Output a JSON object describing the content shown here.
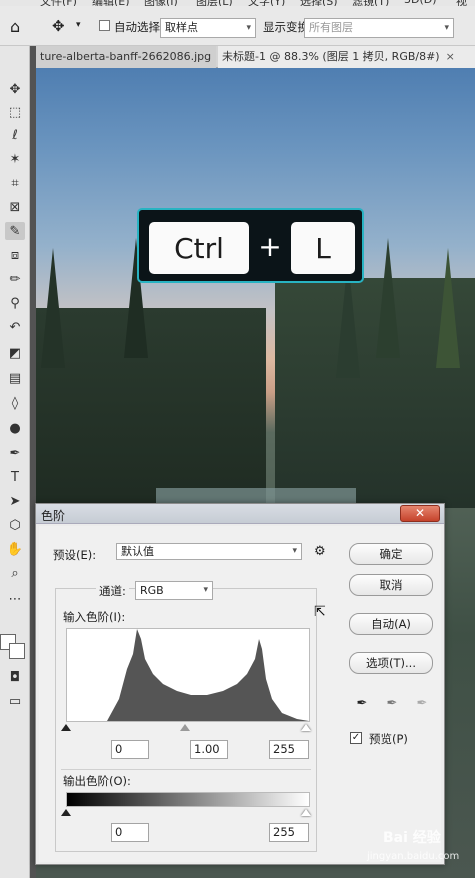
{
  "menubar": {
    "items": [
      "文件(F)",
      "编辑(E)",
      "图像(I)",
      "图层(L)",
      "文字(Y)",
      "选择(S)",
      "滤镜(T)",
      "3D(D)",
      "视图(V)"
    ]
  },
  "optbar": {
    "auto_select_label": "自动选择",
    "sample_label": "取样点",
    "show_transform_label": "显示变换",
    "layers_placeholder": "所有图层"
  },
  "tabs": [
    {
      "label": "ture-alberta-banff-2662086.jpg"
    },
    {
      "label": "未标题-1 @ 88.3% (图层 1 拷贝, RGB/8#)"
    }
  ],
  "shortcut": {
    "key1": "Ctrl",
    "plus": "+",
    "key2": "L"
  },
  "dialog": {
    "title": "色阶",
    "close_label": "✕",
    "preset_label": "预设(E):",
    "preset_value": "默认值",
    "channel_label": "通道:",
    "channel_value": "RGB",
    "input_levels_label": "输入色阶(I):",
    "input_black": "0",
    "input_gamma": "1.00",
    "input_white": "255",
    "output_levels_label": "输出色阶(O):",
    "output_black": "0",
    "output_white": "255",
    "buttons": {
      "ok": "确定",
      "cancel": "取消",
      "auto": "自动(A)",
      "options": "选项(T)..."
    },
    "preview_label": "预览(P)",
    "preview_checked": true
  },
  "watermark": {
    "text1": "Bai 经验",
    "text2": "jingyan.baidu.com"
  },
  "icons": [
    "move-icon",
    "marquee-icon",
    "lasso-icon",
    "magic-wand-icon",
    "crop-icon",
    "frame-icon",
    "eyedropper-icon",
    "patch-icon",
    "brush-icon",
    "stamp-icon",
    "history-brush-icon",
    "eraser-icon",
    "gradient-icon",
    "blur-icon",
    "dodge-icon",
    "pen-icon",
    "type-icon",
    "path-select-icon",
    "shape-icon",
    "hand-icon",
    "zoom-icon",
    "more-icon"
  ]
}
